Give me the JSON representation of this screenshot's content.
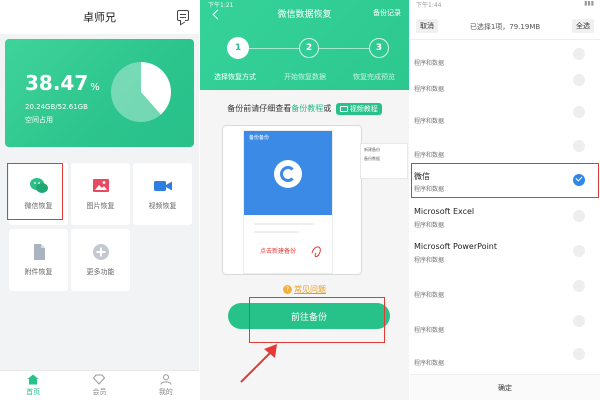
{
  "colors": {
    "accent_green": "#27c28a",
    "highlight_red": "#e53935",
    "check_blue": "#2f87e8",
    "mock_blue": "#3b8be6"
  },
  "panel1": {
    "title": "卓师兄",
    "storage": {
      "percent_value": "38.47",
      "percent_sign": "%",
      "size": "20.24GB/52.61GB",
      "label": "空间占用",
      "used_fraction": 0.3847
    },
    "tiles": [
      {
        "label": "微信恢复",
        "icon": "wechat-icon",
        "highlighted": true
      },
      {
        "label": "图片恢复",
        "icon": "image-icon",
        "highlighted": false
      },
      {
        "label": "视频恢复",
        "icon": "video-icon",
        "highlighted": false
      },
      {
        "label": "附件恢复",
        "icon": "file-icon",
        "highlighted": false
      },
      {
        "label": "更多功能",
        "icon": "plus-icon",
        "highlighted": false
      }
    ],
    "nav": [
      {
        "label": "首页",
        "icon": "home-icon",
        "active": true
      },
      {
        "label": "会员",
        "icon": "diamond-icon",
        "active": false
      },
      {
        "label": "我的",
        "icon": "user-icon",
        "active": false
      }
    ]
  },
  "panel2": {
    "status_time": "下午1:21",
    "title": "微信数据恢复",
    "record_label": "备份记录",
    "steps": [
      {
        "num": "1",
        "label": "选择恢复方式",
        "active": true
      },
      {
        "num": "2",
        "label": "开始恢复数据",
        "active": false
      },
      {
        "num": "3",
        "label": "恢复完成预览",
        "active": false
      }
    ],
    "tip_prefix": "备份前请仔细查看",
    "tip_link": "备份教程",
    "tip_or": "或",
    "video_label": "视频教程",
    "mock": {
      "title": "备份备份",
      "red_text": "点击新建备份",
      "side_line1": "新建备份",
      "side_line2": "备份数据"
    },
    "faq_label": "常见问题",
    "go_button": "前往备份"
  },
  "panel3": {
    "status_time": "下午1:44",
    "cancel": "取消",
    "selected_info": "已选择1项，79.19MB",
    "select_all": "全选",
    "rows": [
      {
        "title": "",
        "sub": "程序和数据",
        "blur": true,
        "checked": false
      },
      {
        "title": "",
        "sub": "程序和数据",
        "blur": true,
        "checked": false
      },
      {
        "title": "",
        "sub": "程序和数据",
        "blur": true,
        "checked": false
      },
      {
        "title": "",
        "sub": "程序和数据",
        "blur": true,
        "checked": false
      },
      {
        "title": "微信",
        "sub": "程序和数据",
        "blur": false,
        "checked": true
      },
      {
        "title": "Microsoft Excel",
        "sub": "程序和数据",
        "blur": false,
        "checked": false
      },
      {
        "title": "Microsoft PowerPoint",
        "sub": "程序和数据",
        "blur": false,
        "checked": false
      },
      {
        "title": "",
        "sub": "程序和数据",
        "blur": true,
        "checked": false
      },
      {
        "title": "",
        "sub": "程序和数据",
        "blur": true,
        "checked": false
      },
      {
        "title": "",
        "sub": "程序和数据",
        "blur": true,
        "checked": false
      }
    ],
    "confirm": "确定"
  }
}
